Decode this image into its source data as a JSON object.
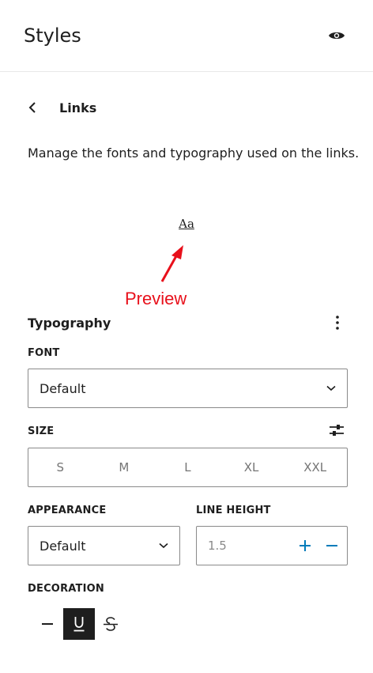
{
  "header": {
    "title": "Styles",
    "preview_icon": "eye-icon"
  },
  "nav": {
    "back_icon": "chevron-left-icon",
    "title": "Links"
  },
  "description": "Manage the fonts and typography used on the links.",
  "preview": {
    "sample_text": "Aa",
    "annotation_label": "Preview",
    "annotation_color": "#e8101b"
  },
  "typography": {
    "title": "Typography",
    "options_icon": "more-vertical-icon",
    "font": {
      "label": "FONT",
      "value": "Default"
    },
    "size": {
      "label": "SIZE",
      "settings_icon": "sliders-icon",
      "options": [
        "S",
        "M",
        "L",
        "XL",
        "XXL"
      ]
    },
    "appearance": {
      "label": "APPEARANCE",
      "value": "Default"
    },
    "line_height": {
      "label": "LINE HEIGHT",
      "value": "1.5",
      "increment_icon": "plus-icon",
      "decrement_icon": "minus-icon"
    },
    "decoration": {
      "label": "DECORATION",
      "options": [
        {
          "icon": "none-dash-icon",
          "selected": false
        },
        {
          "icon": "underline-icon",
          "selected": true
        },
        {
          "icon": "strikethrough-icon",
          "selected": false
        }
      ]
    }
  },
  "colors": {
    "accent": "#007cba",
    "text": "#1e1e1e",
    "muted": "#757575",
    "border": "#8a8a8a"
  }
}
